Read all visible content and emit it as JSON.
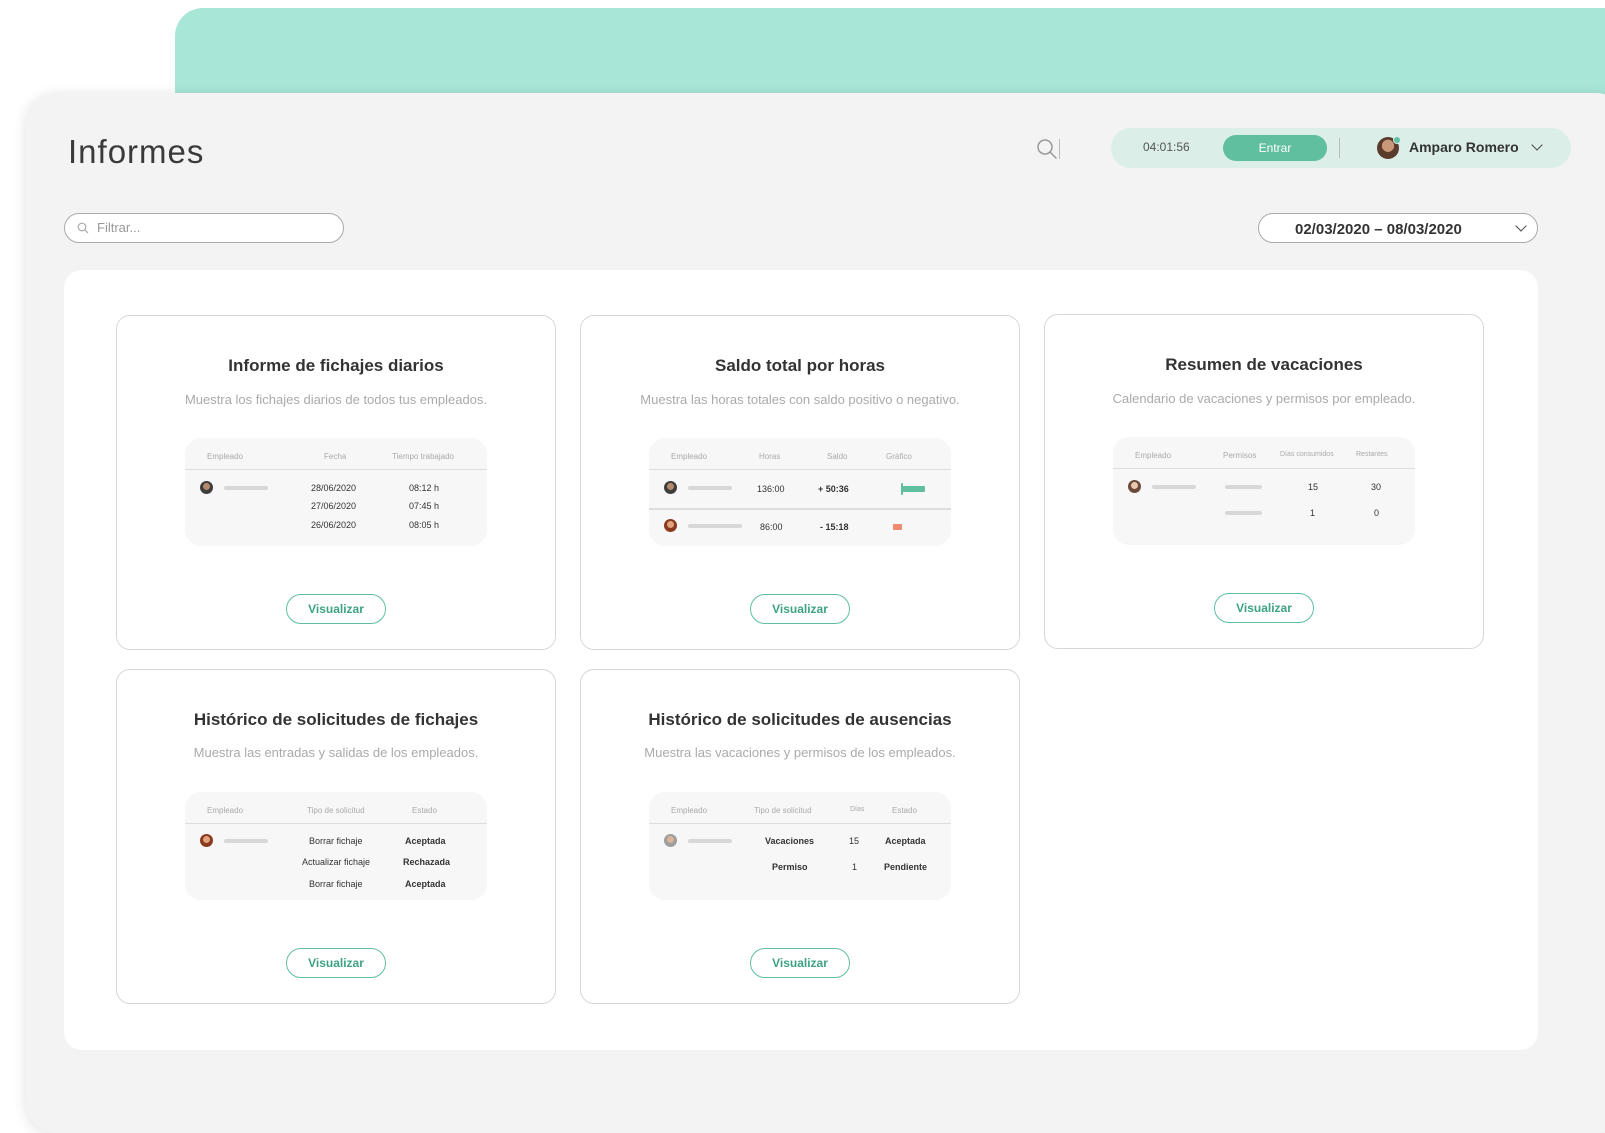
{
  "page": {
    "title": "Informes"
  },
  "header": {
    "timer": "04:01:56",
    "enter_label": "Entrar",
    "user_name": "Amparo Romero"
  },
  "filter": {
    "placeholder": "Filtrar..."
  },
  "date_range": {
    "label": "02/03/2020 – 08/03/2020"
  },
  "colors": {
    "accent": "#5fbf9f",
    "mint": "#a8e6d7",
    "positive": "#4bb98f",
    "negative": "#ef8a6f",
    "pending": "#f5c26b"
  },
  "cards": [
    {
      "title": "Informe de fichajes diarios",
      "description": "Muestra los fichajes diarios de todos tus empleados.",
      "headers": [
        "Empleado",
        "Fecha",
        "Tiempo trabajado"
      ],
      "rows": [
        {
          "date": "28/06/2020",
          "time": "08:12 h"
        },
        {
          "date": "27/06/2020",
          "time": "07:45 h"
        },
        {
          "date": "26/06/2020",
          "time": "08:05 h"
        }
      ],
      "button": "Visualizar"
    },
    {
      "title": "Saldo total por horas",
      "description": "Muestra las horas totales con saldo positivo o negativo.",
      "headers": [
        "Empleado",
        "Horas",
        "Saldo",
        "Gráfico"
      ],
      "rows": [
        {
          "hours": "136:00",
          "balance": "+ 50:36"
        },
        {
          "hours": "86:00",
          "balance": "- 15:18"
        }
      ],
      "button": "Visualizar"
    },
    {
      "title": "Resumen de vacaciones",
      "description": "Calendario de vacaciones y permisos por empleado.",
      "headers": [
        "Empleado",
        "Permisos",
        "Días consumidos",
        "Restantes"
      ],
      "rows": [
        {
          "consumed": "15",
          "remaining": "30"
        },
        {
          "consumed": "1",
          "remaining": "0"
        }
      ],
      "button": "Visualizar"
    },
    {
      "title": "Histórico de solicitudes de fichajes",
      "description": "Muestra las entradas y salidas de los empleados.",
      "headers": [
        "Empleado",
        "Tipo de solicitud",
        "Estado"
      ],
      "rows": [
        {
          "type": "Borrar fichaje",
          "status": "Aceptada"
        },
        {
          "type": "Actualizar fichaje",
          "status": "Rechazada"
        },
        {
          "type": "Borrar fichaje",
          "status": "Aceptada"
        }
      ],
      "button": "Visualizar"
    },
    {
      "title": "Histórico de solicitudes de ausencias",
      "description": "Muestra las vacaciones y permisos de los empleados.",
      "headers": [
        "Empleado",
        "Tipo de solicitud",
        "Días",
        "Estado"
      ],
      "rows": [
        {
          "type": "Vacaciones",
          "days": "15",
          "status": "Aceptada"
        },
        {
          "type": "Permiso",
          "days": "1",
          "status": "Pendiente"
        }
      ],
      "button": "Visualizar"
    }
  ]
}
